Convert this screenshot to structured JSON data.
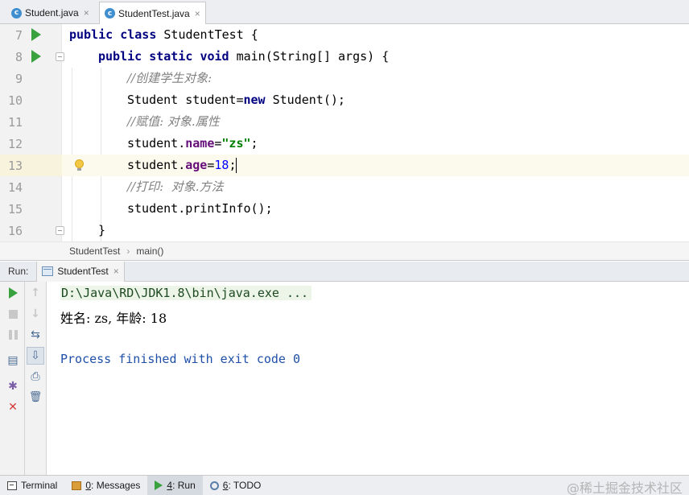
{
  "tabs": [
    {
      "icon": "c",
      "label": "Student.java",
      "close": "×",
      "active": false
    },
    {
      "icon": "c",
      "label": "StudentTest.java",
      "close": "×",
      "active": true
    }
  ],
  "editor": {
    "lines": [
      {
        "num": "7",
        "parts": [
          [
            "kw",
            "public"
          ],
          [
            "p",
            " "
          ],
          [
            "kw",
            "class"
          ],
          [
            "p",
            " StudentTest {"
          ]
        ]
      },
      {
        "num": "8",
        "parts": [
          [
            "kw",
            "public"
          ],
          [
            "p",
            " "
          ],
          [
            "kw",
            "static"
          ],
          [
            "p",
            " "
          ],
          [
            "kw",
            "void"
          ],
          [
            "p",
            " main(String[] args) {"
          ]
        ]
      },
      {
        "num": "9",
        "parts": [
          [
            "cmt",
            "//创建学生对象:"
          ]
        ]
      },
      {
        "num": "10",
        "parts": [
          [
            "p",
            "Student student="
          ],
          [
            "kw",
            "new"
          ],
          [
            "p",
            " Student();"
          ]
        ]
      },
      {
        "num": "11",
        "parts": [
          [
            "cmt",
            "//赋值: 对象.属性"
          ]
        ]
      },
      {
        "num": "12",
        "parts": [
          [
            "p",
            "student."
          ],
          [
            "fld",
            "name"
          ],
          [
            "p",
            "="
          ],
          [
            "str",
            "\"zs\""
          ],
          [
            "p",
            ";"
          ]
        ]
      },
      {
        "num": "13",
        "parts": [
          [
            "p",
            "student."
          ],
          [
            "fld",
            "age"
          ],
          [
            "p",
            "="
          ],
          [
            "num",
            "18"
          ],
          [
            "p",
            ";"
          ]
        ]
      },
      {
        "num": "14",
        "parts": [
          [
            "cmt",
            "//打印:  对象.方法"
          ]
        ]
      },
      {
        "num": "15",
        "parts": [
          [
            "p",
            "student.printInfo();"
          ]
        ]
      },
      {
        "num": "16",
        "parts": [
          [
            "p",
            "}"
          ]
        ]
      }
    ]
  },
  "breadcrumb": {
    "class_name": "StudentTest",
    "separator": "›",
    "method": "main()"
  },
  "run_panel": {
    "label": "Run:",
    "config_tab": "StudentTest",
    "close": "×",
    "console": {
      "command": "D:\\Java\\RD\\JDK1.8\\bin\\java.exe ...",
      "output": "姓名: zs, 年龄: 18",
      "finished": "Process finished with exit code 0"
    }
  },
  "bottom_bar": {
    "terminal": "Terminal",
    "messages_key": "0",
    "messages": ": Messages",
    "run_key": "4",
    "run": ": Run",
    "todo_key": "6",
    "todo": ": TODO",
    "watermark": "@稀土掘金技术社区"
  },
  "icons": {
    "tool_up": "↑",
    "tool_down": "↓",
    "tool_wrap": "⇆",
    "tool_scroll": "⇩",
    "tool_print": "⎙",
    "tool_trash": "🗑",
    "tool_layout": "▤",
    "tool_pin": "✱",
    "tool_close": "✕"
  },
  "colors": {
    "keyword": "#000080",
    "field": "#660e7a",
    "string": "#008000",
    "number": "#0000ff",
    "comment": "#808080",
    "run_green": "#3aa13f",
    "exit_text": "#1f4fa8"
  }
}
